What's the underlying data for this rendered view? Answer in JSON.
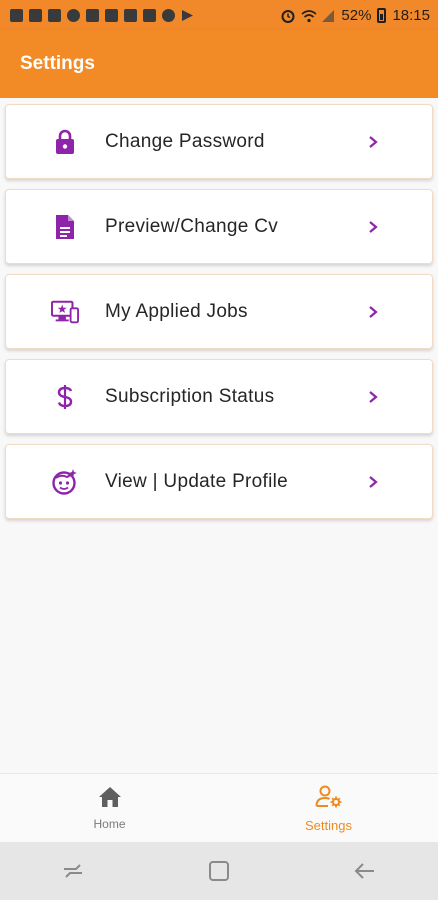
{
  "status_bar": {
    "battery_percent": "52%",
    "time": "18:15"
  },
  "app_bar": {
    "title": "Settings"
  },
  "menu": {
    "items": [
      {
        "label": "Change Password",
        "icon": "lock-icon"
      },
      {
        "label": "Preview/Change Cv",
        "icon": "document-icon"
      },
      {
        "label": "My Applied Jobs",
        "icon": "devices-star-icon"
      },
      {
        "label": "Subscription Status",
        "icon": "dollar-icon"
      },
      {
        "label": "View | Update Profile",
        "icon": "face-icon"
      }
    ]
  },
  "bottom_nav": {
    "home_label": "Home",
    "settings_label": "Settings",
    "active": "settings"
  },
  "colors": {
    "accent": "#f28a26",
    "icon_purple": "#8e24aa",
    "chevron_purple": "#8e24aa",
    "active_tab": "#f08a1c"
  }
}
